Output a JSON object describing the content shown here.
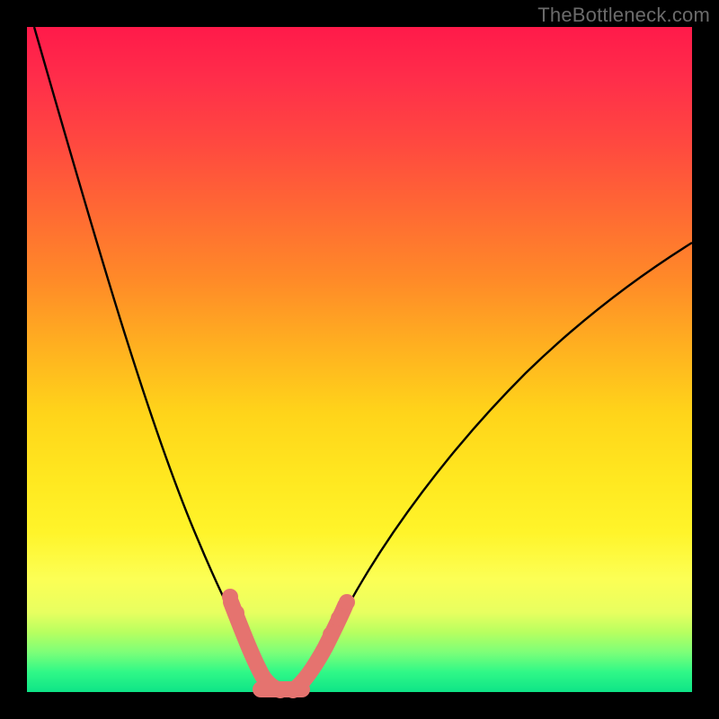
{
  "watermark": "TheBottleneck.com",
  "chart_data": {
    "type": "line",
    "title": "",
    "xlabel": "",
    "ylabel": "",
    "xlim": [
      0,
      100
    ],
    "ylim": [
      0,
      100
    ],
    "grid": false,
    "x": [
      0,
      2,
      4,
      6,
      8,
      10,
      12,
      14,
      16,
      18,
      20,
      22,
      24,
      26,
      28,
      30,
      31,
      32,
      33,
      34,
      35,
      36,
      37,
      38,
      39,
      40,
      42,
      44,
      46,
      48,
      50,
      55,
      60,
      65,
      70,
      75,
      80,
      85,
      90,
      95,
      100
    ],
    "series": [
      {
        "name": "left_curve",
        "color": "#000000",
        "x": [
          1,
          2,
          4,
          6,
          8,
          10,
          12,
          14,
          16,
          18,
          20,
          22,
          24,
          26,
          28,
          30,
          31,
          32,
          33,
          34
        ],
        "y": [
          100,
          96,
          86,
          76,
          66,
          57,
          49,
          42,
          35,
          29,
          24,
          19,
          15,
          11,
          8,
          5,
          3,
          1.5,
          0.5,
          0
        ]
      },
      {
        "name": "right_curve",
        "color": "#000000",
        "x": [
          36,
          37,
          38,
          39,
          40,
          42,
          44,
          46,
          48,
          50,
          55,
          60,
          65,
          70,
          75,
          80,
          85,
          90,
          95,
          100
        ],
        "y": [
          0,
          0.5,
          1.5,
          3,
          5,
          8,
          12,
          16,
          20,
          24,
          32,
          39,
          45,
          50,
          54,
          58,
          61,
          64,
          66,
          68
        ]
      },
      {
        "name": "marker_band",
        "color": "#e5736f",
        "x": [
          27,
          28,
          29,
          30,
          31,
          32,
          33,
          34,
          35,
          36,
          37,
          38,
          39,
          40,
          41,
          42
        ],
        "y": [
          14,
          11,
          8,
          6,
          4,
          2,
          1,
          0,
          0,
          0,
          1,
          2,
          4,
          6,
          9,
          12
        ]
      }
    ],
    "annotations": []
  },
  "colors": {
    "curve": "#000000",
    "markers": "#e5736f",
    "frame": "#000000"
  }
}
